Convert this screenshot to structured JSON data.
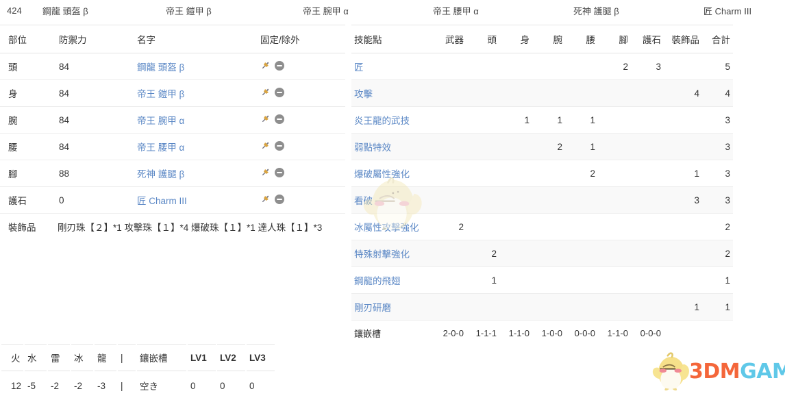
{
  "summary_strip": {
    "total_defense": "424",
    "pieces": [
      "鋼龍 頭盔 β",
      "帝王 鎧甲 β",
      "帝王 腕甲 α",
      "帝王 腰甲 α",
      "死神 護腿 β",
      "匠 Charm III"
    ]
  },
  "equipment_table": {
    "headers": [
      "部位",
      "防禦力",
      "名字",
      "固定/除外"
    ],
    "rows": [
      {
        "part": "頭",
        "defense": "84",
        "name": "鋼龍 頭盔 β",
        "pin_icon": "pushpin-icon",
        "exclude_icon": "minus-circle-icon"
      },
      {
        "part": "身",
        "defense": "84",
        "name": "帝王 鎧甲 β",
        "pin_icon": "pushpin-icon",
        "exclude_icon": "minus-circle-icon"
      },
      {
        "part": "腕",
        "defense": "84",
        "name": "帝王 腕甲 α",
        "pin_icon": "pushpin-icon",
        "exclude_icon": "minus-circle-icon"
      },
      {
        "part": "腰",
        "defense": "84",
        "name": "帝王 腰甲 α",
        "pin_icon": "pushpin-icon",
        "exclude_icon": "minus-circle-icon"
      },
      {
        "part": "腳",
        "defense": "88",
        "name": "死神 護腿 β",
        "pin_icon": "pushpin-icon",
        "exclude_icon": "minus-circle-icon"
      },
      {
        "part": "護石",
        "defense": "0",
        "name": "匠 Charm III",
        "pin_icon": "pushpin-icon",
        "exclude_icon": "minus-circle-icon"
      }
    ],
    "decorations_label": "裝飾品",
    "decorations_value": "剛刃珠【２】*1 攻擊珠【１】*4 爆破珠【１】*1 達人珠【１】*3"
  },
  "skills_table": {
    "headers": [
      "技能點",
      "武器",
      "頭",
      "身",
      "腕",
      "腰",
      "腳",
      "護石",
      "裝飾品",
      "合計"
    ],
    "rows": [
      {
        "skill": "匠",
        "weapon": "",
        "head": "",
        "body": "",
        "arms": "",
        "waist": "",
        "legs": "2",
        "charm": "3",
        "deco": "",
        "total": "5"
      },
      {
        "skill": "攻擊",
        "weapon": "",
        "head": "",
        "body": "",
        "arms": "",
        "waist": "",
        "legs": "",
        "charm": "",
        "deco": "4",
        "total": "4"
      },
      {
        "skill": "炎王龍的武技",
        "weapon": "",
        "head": "",
        "body": "1",
        "arms": "1",
        "waist": "1",
        "legs": "",
        "charm": "",
        "deco": "",
        "total": "3"
      },
      {
        "skill": "弱點特效",
        "weapon": "",
        "head": "",
        "body": "",
        "arms": "2",
        "waist": "1",
        "legs": "",
        "charm": "",
        "deco": "",
        "total": "3"
      },
      {
        "skill": "爆破屬性強化",
        "weapon": "",
        "head": "",
        "body": "",
        "arms": "",
        "waist": "2",
        "legs": "",
        "charm": "",
        "deco": "1",
        "total": "3"
      },
      {
        "skill": "看破",
        "weapon": "",
        "head": "",
        "body": "",
        "arms": "",
        "waist": "",
        "legs": "",
        "charm": "",
        "deco": "3",
        "total": "3"
      },
      {
        "skill": "冰屬性攻擊強化",
        "weapon": "2",
        "head": "",
        "body": "",
        "arms": "",
        "waist": "",
        "legs": "",
        "charm": "",
        "deco": "",
        "total": "2"
      },
      {
        "skill": "特殊射擊強化",
        "weapon": "",
        "head": "2",
        "body": "",
        "arms": "",
        "waist": "",
        "legs": "",
        "charm": "",
        "deco": "",
        "total": "2"
      },
      {
        "skill": "鋼龍的飛翅",
        "weapon": "",
        "head": "1",
        "body": "",
        "arms": "",
        "waist": "",
        "legs": "",
        "charm": "",
        "deco": "",
        "total": "1"
      },
      {
        "skill": "剛刃研磨",
        "weapon": "",
        "head": "",
        "body": "",
        "arms": "",
        "waist": "",
        "legs": "",
        "charm": "",
        "deco": "1",
        "total": "1"
      }
    ],
    "slots_row": {
      "label": "鑲嵌槽",
      "weapon": "2-0-0",
      "head": "1-1-1",
      "body": "1-1-0",
      "arms": "1-0-0",
      "waist": "0-0-0",
      "legs": "1-1-0",
      "charm": "0-0-0",
      "deco": "",
      "total": ""
    }
  },
  "resistance_table": {
    "headers": [
      "火",
      "水",
      "雷",
      "冰",
      "龍",
      "|",
      "鑲嵌槽",
      "LV1",
      "LV2",
      "LV3"
    ],
    "values": [
      "12",
      "-5",
      "-2",
      "-2",
      "-3",
      "|",
      "空き",
      "0",
      "0",
      "0"
    ]
  },
  "watermark": {
    "brand_part1": "3DM",
    "brand_part2": "GAME",
    "mascot_icon": "bird-mascot-icon"
  },
  "colors": {
    "link": "#5a87c5",
    "text": "#333333",
    "row_stripe": "#f9f9f9",
    "border": "#e4e4e4",
    "brand_orange": "#f4663a",
    "brand_cyan": "#5fc8e8"
  }
}
